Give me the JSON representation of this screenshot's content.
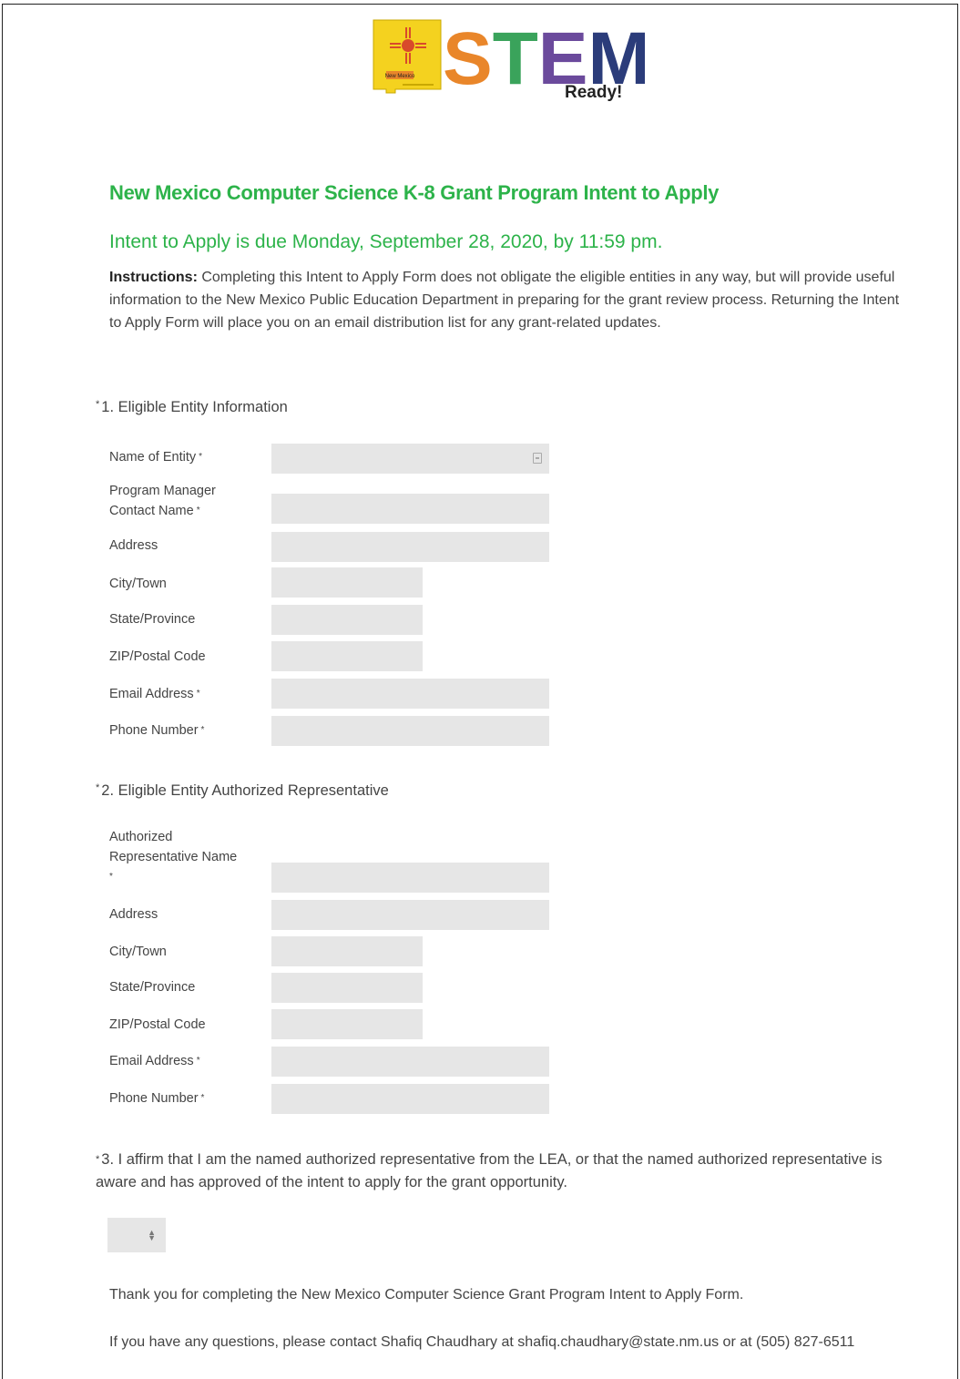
{
  "logo": {
    "main_text": "STEM",
    "sub_text": "Ready!",
    "badge_text": "New Mexico",
    "colors": {
      "state_yellow": "#f4d21f",
      "zia_red": "#d94a2b",
      "purple": "#6b4a9c",
      "green": "#3aa35b",
      "orange": "#e9862a",
      "navy": "#2b3c7a"
    }
  },
  "form": {
    "title": "New Mexico Computer Science K-8 Grant Program Intent to Apply",
    "due_date": "Intent to Apply is due Monday, September 28, 2020, by 11:59 pm.",
    "instructions_label": "Instructions:",
    "instructions_text": " Completing this Intent to Apply Form does not obligate the eligible entities in any way, but will provide useful information to the New Mexico Public Education Department in preparing for the grant review process. Returning the Intent to Apply Form will place you on an email distribution list for any grant-related updates."
  },
  "q1": {
    "required_mark": "*",
    "title": "1. Eligible Entity Information",
    "fields": [
      {
        "label": "Name of Entity",
        "required": "*",
        "value": ""
      },
      {
        "label": "Program Manager Contact Name",
        "required": "*",
        "value": ""
      },
      {
        "label": "Address",
        "required": "",
        "value": ""
      },
      {
        "label": "City/Town",
        "required": "",
        "value": ""
      },
      {
        "label": "State/Province",
        "required": "",
        "value": ""
      },
      {
        "label": "ZIP/Postal Code",
        "required": "",
        "value": ""
      },
      {
        "label": "Email Address",
        "required": "*",
        "value": ""
      },
      {
        "label": "Phone Number",
        "required": "*",
        "value": ""
      }
    ]
  },
  "q2": {
    "required_mark": "*",
    "title": "2. Eligible Entity Authorized Representative",
    "fields": [
      {
        "label": "Authorized Representative Name",
        "required": "*",
        "value": ""
      },
      {
        "label": "Address",
        "required": "",
        "value": ""
      },
      {
        "label": "City/Town",
        "required": "",
        "value": ""
      },
      {
        "label": "State/Province",
        "required": "",
        "value": ""
      },
      {
        "label": "ZIP/Postal Code",
        "required": "",
        "value": ""
      },
      {
        "label": "Email Address",
        "required": "*",
        "value": ""
      },
      {
        "label": "Phone Number",
        "required": "*",
        "value": ""
      }
    ]
  },
  "q3": {
    "required_mark": "*",
    "text": "3. I affirm that I am the named authorized representative from the LEA, or that the named authorized representative is aware and has approved of the intent to apply for the grant opportunity.",
    "select_value": ""
  },
  "footer": {
    "thanks": "Thank you for completing the New Mexico Computer Science Grant Program Intent to Apply Form.",
    "contact": "If you have any questions, please contact Shafiq Chaudhary at shafiq.chaudhary@state.nm.us or at (505) 827-6511"
  }
}
